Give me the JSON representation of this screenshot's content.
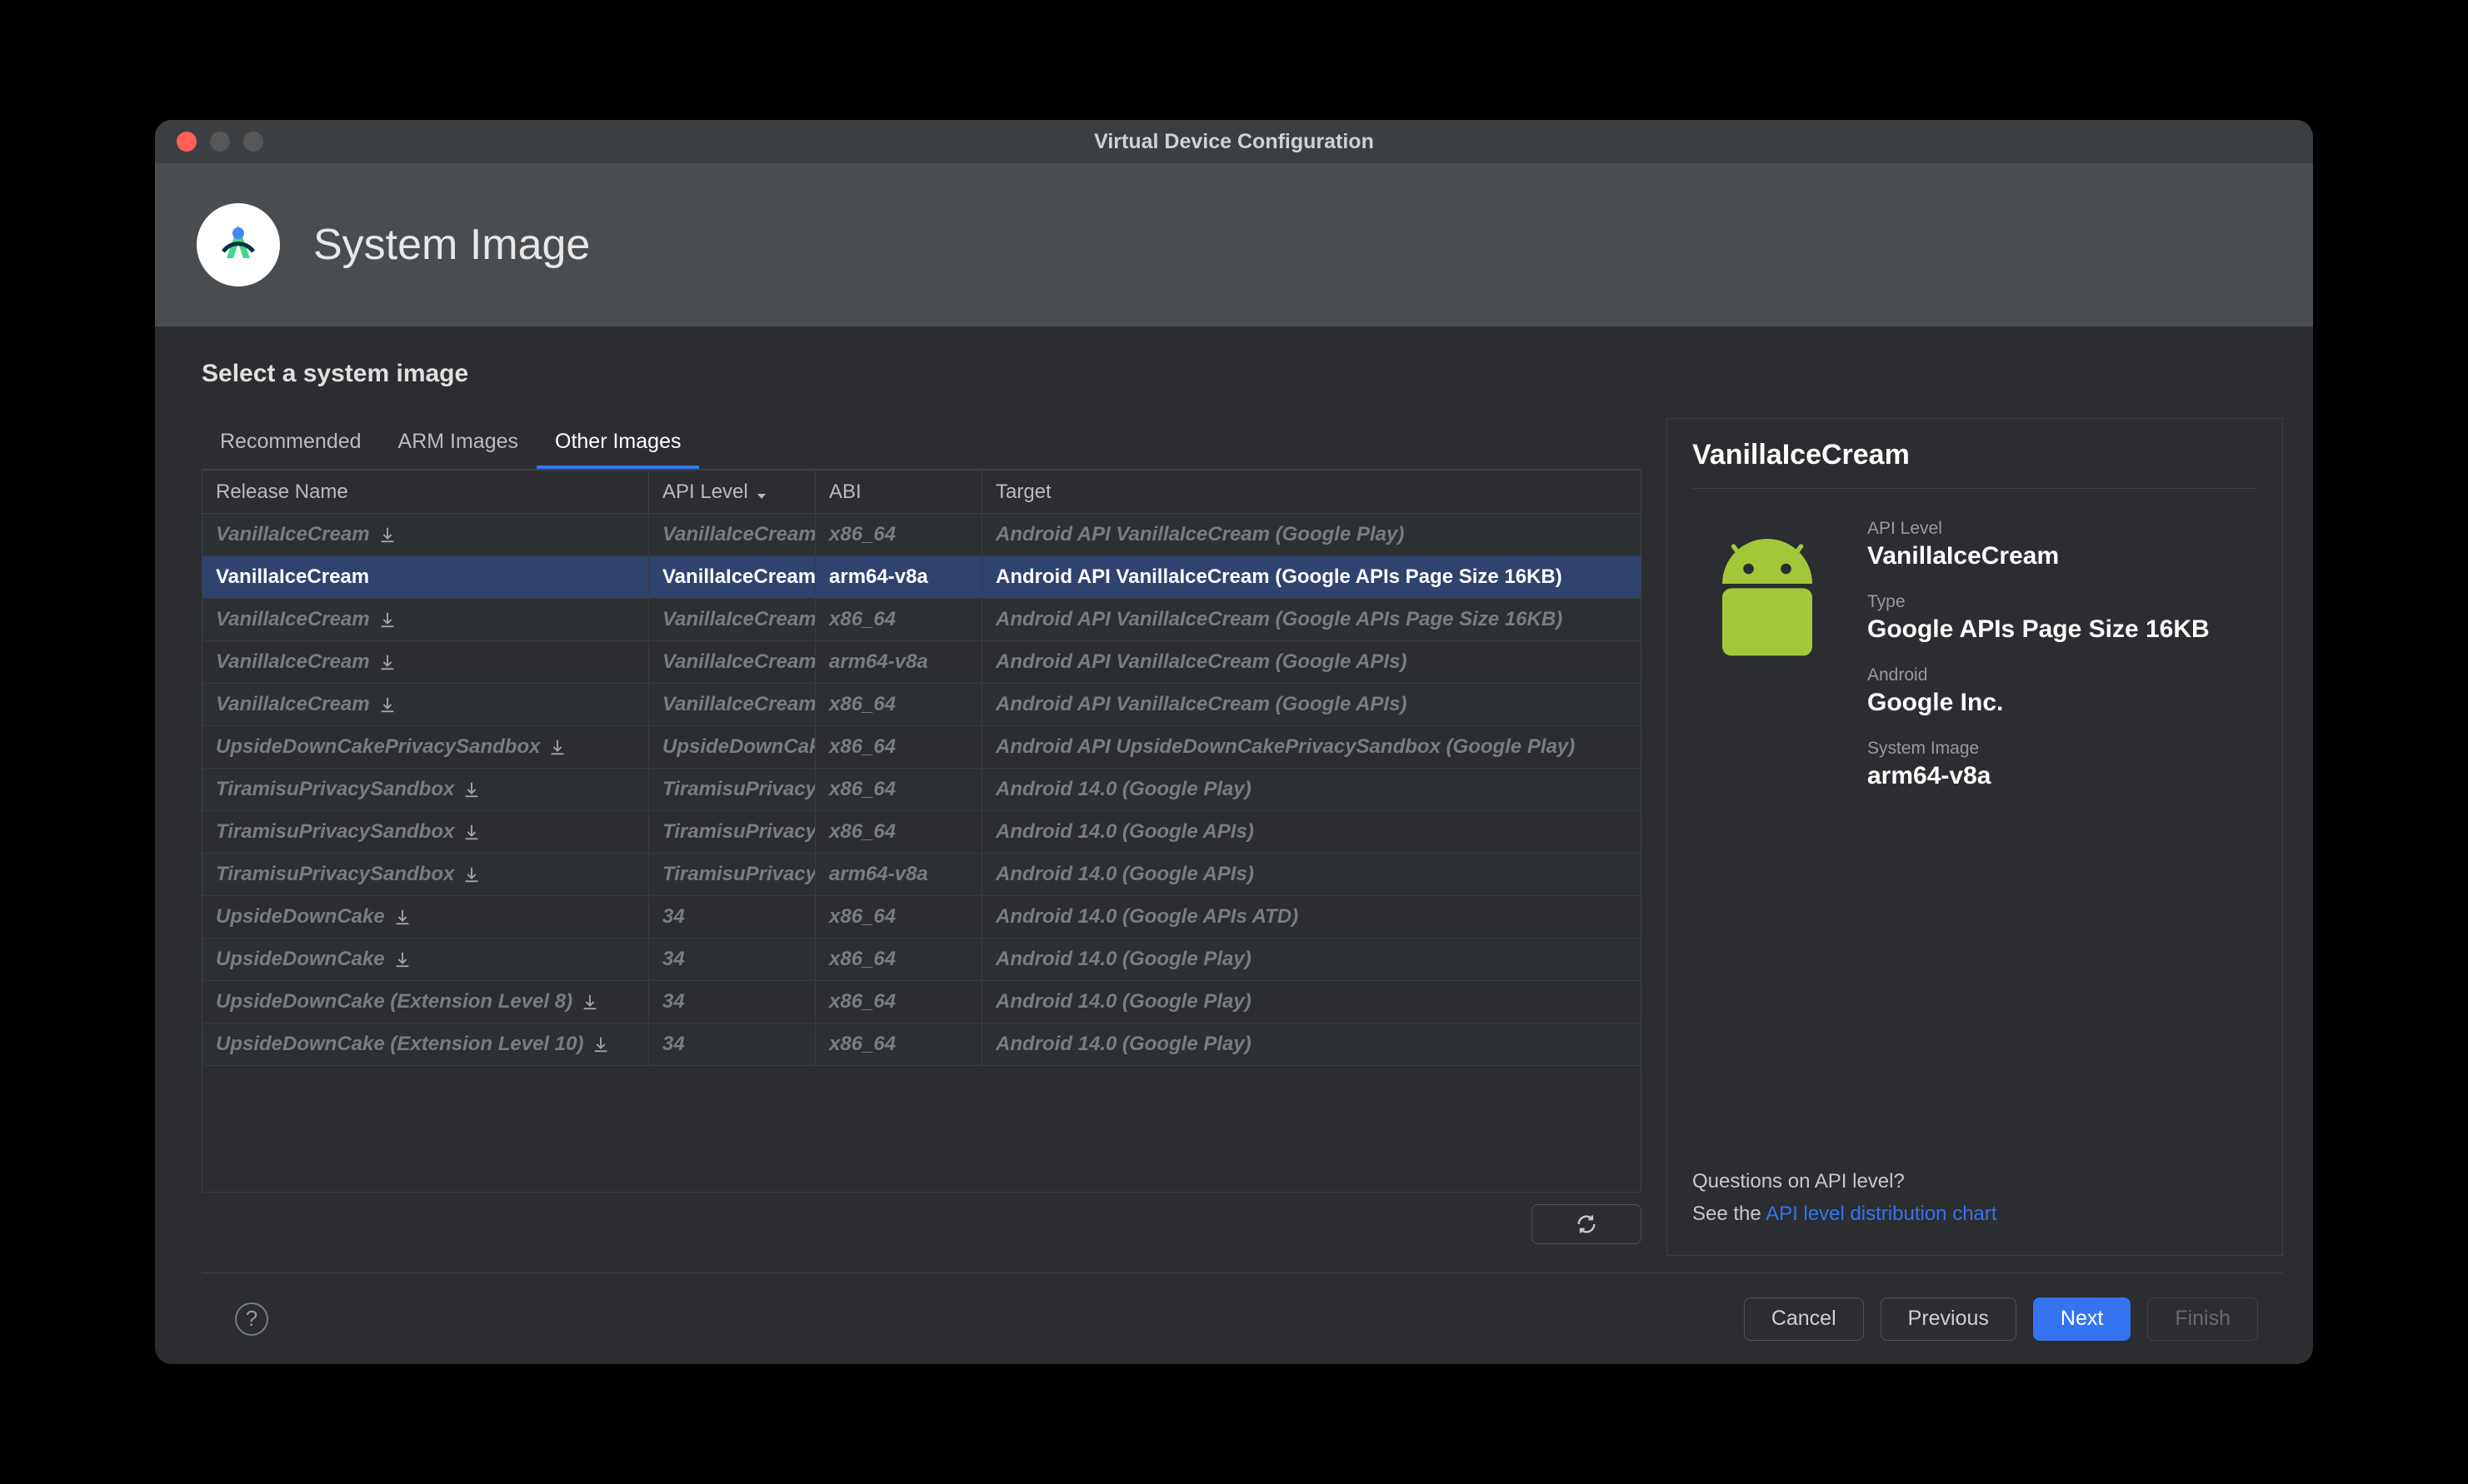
{
  "window": {
    "title": "Virtual Device Configuration"
  },
  "header": {
    "title": "System Image"
  },
  "subtitle": "Select a system image",
  "tabs": [
    {
      "label": "Recommended",
      "active": false
    },
    {
      "label": "ARM Images",
      "active": false
    },
    {
      "label": "Other Images",
      "active": true
    }
  ],
  "columns": {
    "release": "Release Name",
    "api": "API Level",
    "abi": "ABI",
    "target": "Target"
  },
  "rows": [
    {
      "name": "VanillaIceCream",
      "download": true,
      "api": "VanillaIceCream",
      "abi": "x86_64",
      "target": "Android API VanillaIceCream (Google Play)",
      "selected": false
    },
    {
      "name": "VanillaIceCream",
      "download": false,
      "api": "VanillaIceCream",
      "abi": "arm64-v8a",
      "target": "Android API VanillaIceCream (Google APIs Page Size 16KB)",
      "selected": true
    },
    {
      "name": "VanillaIceCream",
      "download": true,
      "api": "VanillaIceCream",
      "abi": "x86_64",
      "target": "Android API VanillaIceCream (Google APIs Page Size 16KB)",
      "selected": false
    },
    {
      "name": "VanillaIceCream",
      "download": true,
      "api": "VanillaIceCream",
      "abi": "arm64-v8a",
      "target": "Android API VanillaIceCream (Google APIs)",
      "selected": false
    },
    {
      "name": "VanillaIceCream",
      "download": true,
      "api": "VanillaIceCream",
      "abi": "x86_64",
      "target": "Android API VanillaIceCream (Google APIs)",
      "selected": false
    },
    {
      "name": "UpsideDownCakePrivacySandbox",
      "download": true,
      "api": "UpsideDownCak",
      "abi": "x86_64",
      "target": "Android API UpsideDownCakePrivacySandbox (Google Play)",
      "selected": false
    },
    {
      "name": "TiramisuPrivacySandbox",
      "download": true,
      "api": "TiramisuPrivacyS",
      "abi": "x86_64",
      "target": "Android 14.0 (Google Play)",
      "selected": false
    },
    {
      "name": "TiramisuPrivacySandbox",
      "download": true,
      "api": "TiramisuPrivacyS",
      "abi": "x86_64",
      "target": "Android 14.0 (Google APIs)",
      "selected": false
    },
    {
      "name": "TiramisuPrivacySandbox",
      "download": true,
      "api": "TiramisuPrivacyS",
      "abi": "arm64-v8a",
      "target": "Android 14.0 (Google APIs)",
      "selected": false
    },
    {
      "name": "UpsideDownCake",
      "download": true,
      "api": "34",
      "abi": "x86_64",
      "target": "Android 14.0 (Google APIs ATD)",
      "selected": false
    },
    {
      "name": "UpsideDownCake",
      "download": true,
      "api": "34",
      "abi": "x86_64",
      "target": "Android 14.0 (Google Play)",
      "selected": false
    },
    {
      "name": "UpsideDownCake (Extension Level 8)",
      "download": true,
      "api": "34",
      "abi": "x86_64",
      "target": "Android 14.0 (Google Play)",
      "selected": false
    },
    {
      "name": "UpsideDownCake (Extension Level 10)",
      "download": true,
      "api": "34",
      "abi": "x86_64",
      "target": "Android 14.0 (Google Play)",
      "selected": false
    }
  ],
  "details": {
    "title": "VanillaIceCream",
    "api_label": "API Level",
    "api_value": "VanillaIceCream",
    "type_label": "Type",
    "type_value": "Google APIs Page Size 16KB",
    "android_label": "Android",
    "android_value": "Google Inc.",
    "sysimg_label": "System Image",
    "sysimg_value": "arm64-v8a",
    "help_q": "Questions on API level?",
    "help_see": "See the ",
    "help_link": "API level distribution chart"
  },
  "footer": {
    "cancel": "Cancel",
    "previous": "Previous",
    "next": "Next",
    "finish": "Finish"
  },
  "colors": {
    "accent": "#3574f0",
    "selected_row": "#2e436e",
    "android_green": "#a4c639"
  }
}
